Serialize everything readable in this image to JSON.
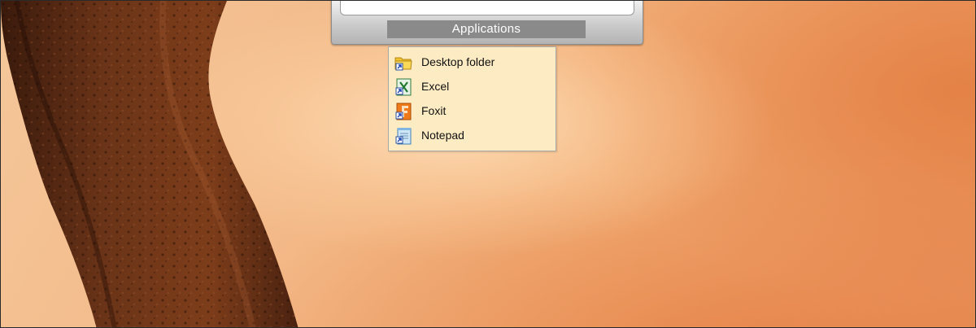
{
  "launcher": {
    "tab_label": "Applications"
  },
  "menu": {
    "items": [
      {
        "label": "Desktop folder",
        "icon": "folder-shortcut-icon"
      },
      {
        "label": "Excel",
        "icon": "excel-shortcut-icon"
      },
      {
        "label": "Foxit",
        "icon": "foxit-shortcut-icon"
      },
      {
        "label": "Notepad",
        "icon": "notepad-shortcut-icon"
      }
    ]
  },
  "colors": {
    "menu_bg": "#fdebc3",
    "tab_bg": "#8a8a8a",
    "desktop_orange": "#f0a86f"
  }
}
